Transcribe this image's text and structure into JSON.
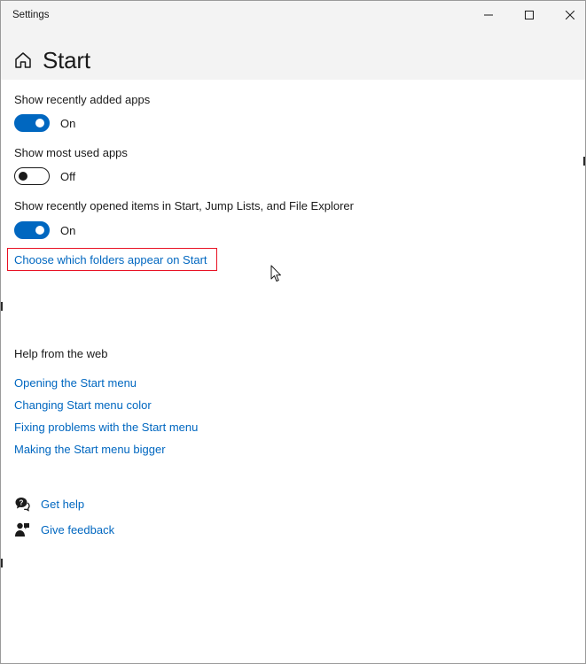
{
  "window": {
    "title": "Settings",
    "caption_buttons": {
      "minimize": "minimize-icon",
      "maximize": "maximize-icon",
      "close": "close-icon"
    }
  },
  "header": {
    "icon": "home-icon",
    "title": "Start"
  },
  "settings": [
    {
      "label": "Show recently added apps",
      "state": "On",
      "checked": true
    },
    {
      "label": "Show most used apps",
      "state": "Off",
      "checked": false
    },
    {
      "label": "Show recently opened items in Start, Jump Lists, and File Explorer",
      "state": "On",
      "checked": true
    }
  ],
  "folders_link": {
    "label": "Choose which folders appear on Start",
    "highlight_color": "#e81123"
  },
  "help": {
    "heading": "Help from the web",
    "links": [
      "Opening the Start menu",
      "Changing Start menu color",
      "Fixing problems with the Start menu",
      "Making the Start menu bigger"
    ]
  },
  "footer": {
    "get_help": {
      "label": "Get help",
      "icon": "get-help-icon"
    },
    "give_feedback": {
      "label": "Give feedback",
      "icon": "feedback-icon"
    }
  },
  "colors": {
    "accent": "#0067c0",
    "title_bar": "#f3f3f3",
    "text": "#1a1a1a"
  }
}
